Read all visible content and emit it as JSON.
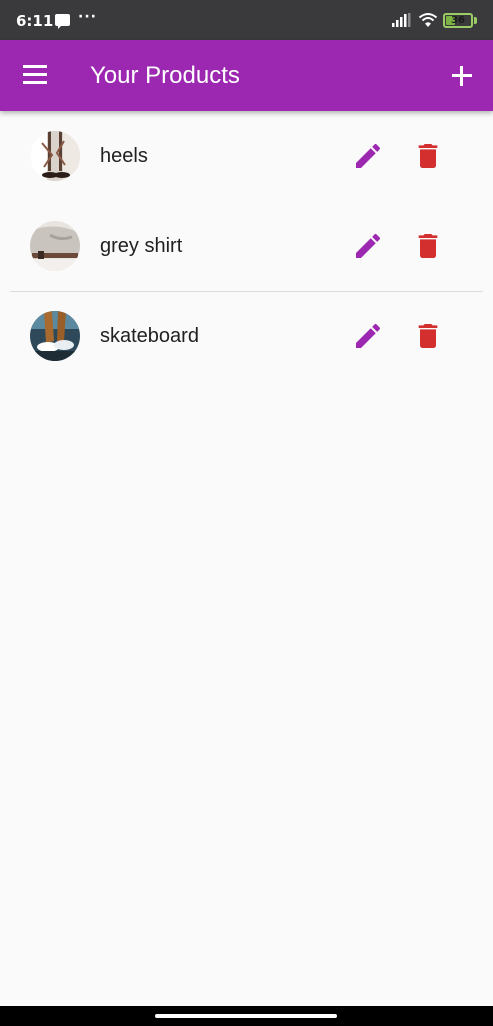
{
  "status_bar": {
    "time": "6:11",
    "battery_level": "36",
    "battery_fraction": 0.36,
    "icons": [
      "message-icon",
      "more-dots-icon",
      "signal-icon",
      "wifi-icon",
      "battery-icon"
    ]
  },
  "app_bar": {
    "title": "Your Products",
    "background_color": "#9c27b0",
    "menu_icon": "menu-icon",
    "add_icon": "add-icon"
  },
  "products": [
    {
      "title": "heels"
    },
    {
      "title": "grey shirt"
    },
    {
      "title": "skateboard"
    }
  ],
  "actions": {
    "edit_icon": "edit-pencil-icon",
    "edit_color": "#9c27b0",
    "delete_icon": "delete-trash-icon",
    "delete_color": "#d32f2f"
  }
}
